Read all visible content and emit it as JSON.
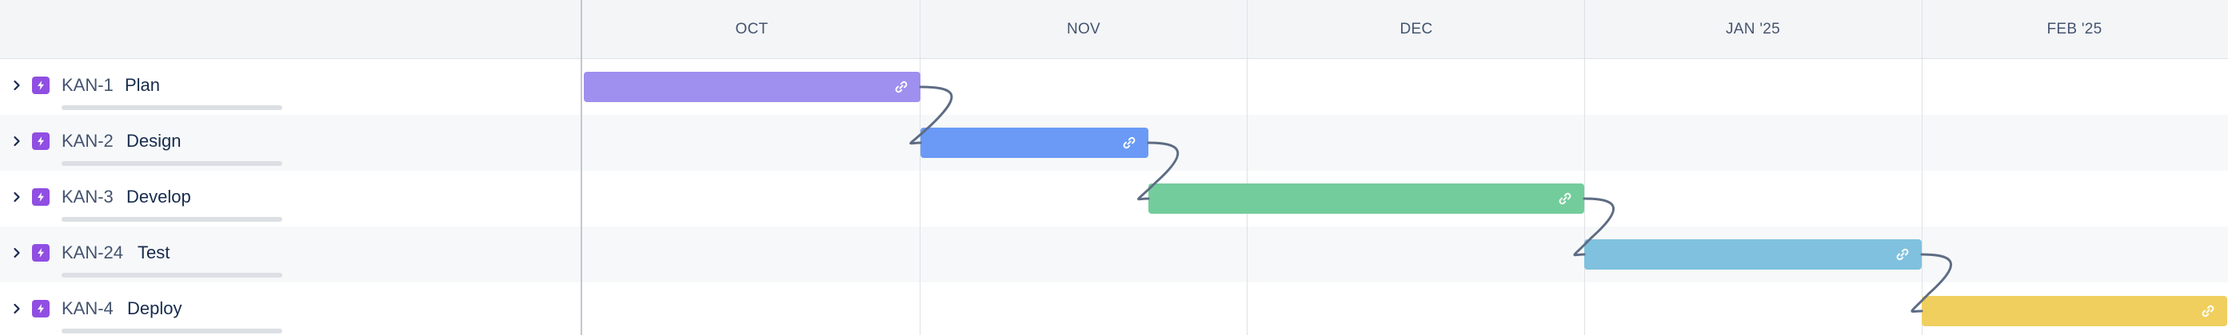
{
  "timeline": {
    "months": [
      "OCT",
      "NOV",
      "DEC",
      "JAN '25",
      "FEB '25"
    ]
  },
  "issues": [
    {
      "key": "KAN-1",
      "summary": "Plan",
      "bar_color": "#9f8fef",
      "type_icon": "epic-lightning-icon"
    },
    {
      "key": "KAN-2",
      "summary": "Design",
      "bar_color": "#6a9af5",
      "type_icon": "epic-lightning-icon"
    },
    {
      "key": "KAN-3",
      "summary": "Develop",
      "bar_color": "#73cc9b",
      "type_icon": "epic-lightning-icon"
    },
    {
      "key": "KAN-24",
      "summary": "Test",
      "bar_color": "#7fc1de",
      "type_icon": "epic-lightning-icon"
    },
    {
      "key": "KAN-4",
      "summary": "Deploy",
      "bar_color": "#f0cf5f",
      "type_icon": "epic-lightning-icon"
    }
  ],
  "colors": {
    "epic_icon": "#904ee2",
    "dependency_line": "#5e6c84",
    "header_bg": "#f4f5f7",
    "row_alt_bg": "#f7f8f9"
  },
  "icons": {
    "row_expander": "chevron-right-icon",
    "bar_link": "link-icon"
  }
}
